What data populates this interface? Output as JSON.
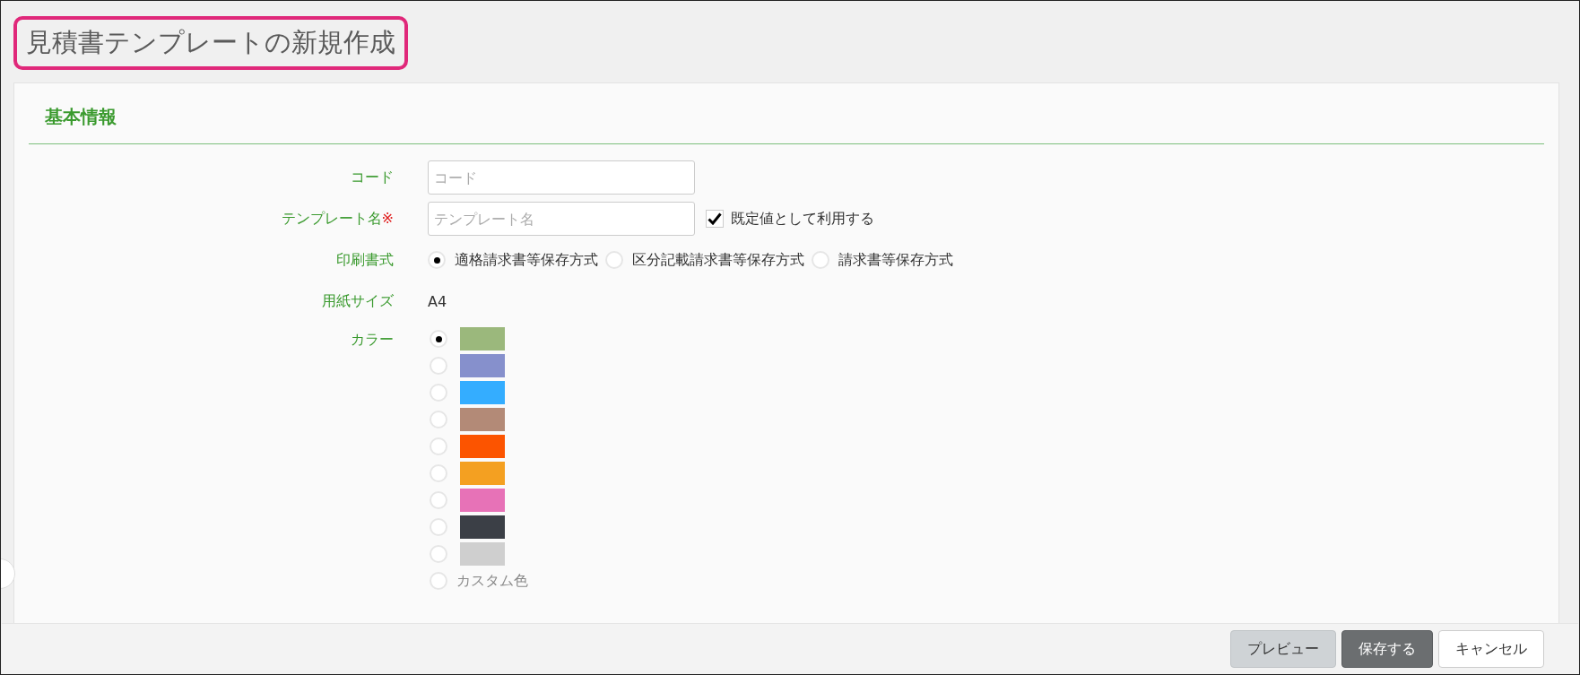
{
  "page_title": "見積書テンプレートの新規作成",
  "section": {
    "title": "基本情報"
  },
  "form": {
    "code": {
      "label": "コード",
      "placeholder": "コード"
    },
    "template_name": {
      "label": "テンプレート名",
      "required_mark": "※",
      "placeholder": "テンプレート名",
      "default_checkbox": {
        "label": "既定値として利用する",
        "checked": true
      }
    },
    "print_format": {
      "label": "印刷書式",
      "options": [
        {
          "label": "適格請求書等保存方式",
          "selected": true
        },
        {
          "label": "区分記載請求書等保存方式",
          "selected": false
        },
        {
          "label": "請求書等保存方式",
          "selected": false
        }
      ]
    },
    "paper_size": {
      "label": "用紙サイズ",
      "value": "A4"
    },
    "color": {
      "label": "カラー",
      "options": [
        {
          "color": "#9bb87c",
          "selected": true
        },
        {
          "color": "#8690cc",
          "selected": false
        },
        {
          "color": "#34adff",
          "selected": false
        },
        {
          "color": "#b38a77",
          "selected": false
        },
        {
          "color": "#fc5400",
          "selected": false
        },
        {
          "color": "#f4a021",
          "selected": false
        },
        {
          "color": "#e772b7",
          "selected": false
        },
        {
          "color": "#3b3f46",
          "selected": false
        },
        {
          "color": "#cfcfcf",
          "selected": false
        }
      ],
      "custom": {
        "label": "カスタム色",
        "selected": false
      }
    }
  },
  "footer": {
    "buttons": [
      {
        "label": "プレビュー",
        "kind": "secondary"
      },
      {
        "label": "保存する",
        "kind": "primary"
      },
      {
        "label": "キャンセル",
        "kind": "plain"
      }
    ]
  }
}
